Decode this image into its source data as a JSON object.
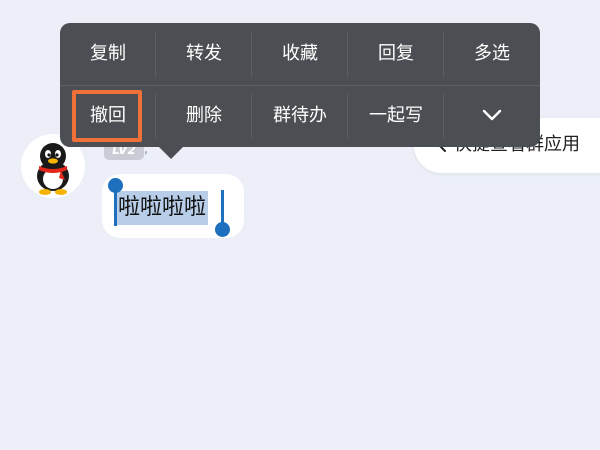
{
  "context_menu": {
    "row1": [
      "复制",
      "转发",
      "收藏",
      "回复",
      "多选"
    ],
    "row2": [
      "撤回",
      "删除",
      "群待办",
      "一起写"
    ],
    "expand_icon": "chevron-down-icon",
    "highlighted_item": "撤回",
    "highlight_color": "#f0703a",
    "background_color": "#4b4e52"
  },
  "message": {
    "text": "啦啦啦啦",
    "level_badge": "LV2",
    "selection_color": "#b7cde8",
    "handle_color": "#1e6fbe"
  },
  "group_app_pill": {
    "label": "快捷查看群应用",
    "icon": "chevron-left-icon"
  },
  "sender": {
    "avatar": "qq-penguin-avatar"
  },
  "colors": {
    "chat_background": "#eceff7",
    "bubble": "#ffffff"
  }
}
